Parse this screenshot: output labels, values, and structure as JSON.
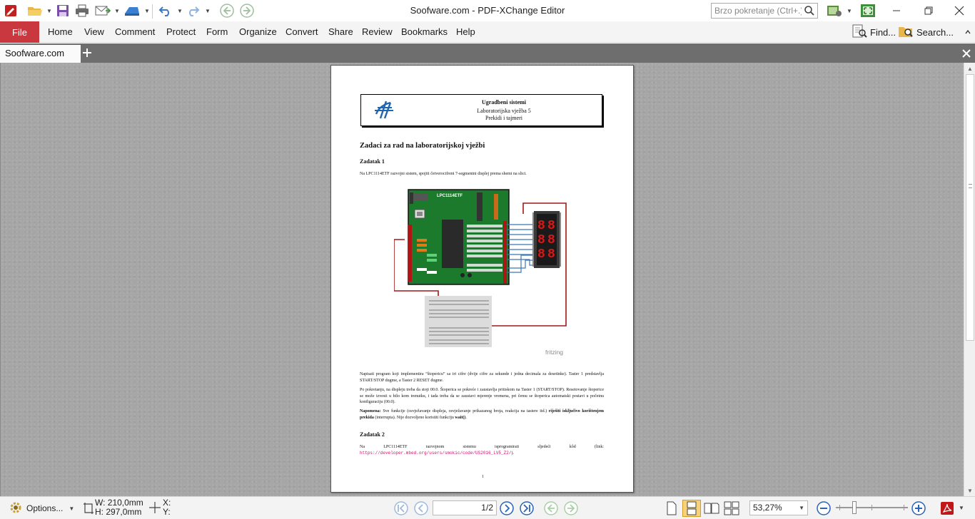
{
  "window": {
    "title": "Soofware.com - PDF-XChange Editor",
    "quick_launch_placeholder": "Brzo pokretanje (Ctrl+.)"
  },
  "menu": {
    "file": "File",
    "items": [
      "Home",
      "View",
      "Comment",
      "Protect",
      "Form",
      "Organize",
      "Convert",
      "Share",
      "Review",
      "Bookmarks",
      "Help"
    ],
    "find": "Find...",
    "search": "Search..."
  },
  "tabs": {
    "active": "Soofware.com"
  },
  "document": {
    "header": {
      "title": "Ugradbeni sistemi",
      "line2": "Laboratorijska vježba 5",
      "line3": "Prekidi i tajmeri"
    },
    "heading": "Zadaci za rad na laboratorijskoj vježbi",
    "task1_title": "Zadatak 1",
    "task1_intro": "Na LPC1114ETF razvojni sistem, spojiti četverocifreni 7-segmentni displej prema shemi na slici.",
    "board_label": "LPC1114ETF",
    "fritzing": "fritzing",
    "p1": "Napisati program koji implementira “štopericu” sa tri cifre (dvije cifre za sekunde i jedna decimala za desetinke). Taster 1 predstavlja START/STOP dugme, a Taster 2 RESET dugme.",
    "p2": "Po pokretanju, na displeju treba da stoji 00.0. Štoperica se pokreće i zaustavlja pritiskom na Taster 1 (START/STOP). Resetovanje štoperice se može izvesti u bilo kom trenutku, i tada treba da se zaustavi mjerenje vremena, pri čemu se štoperica automatski postavi u početnu konfiguraciju (00.0).",
    "note_label": "Napomena:",
    "note_text": "Sve funkcije (osvježavanje displeja, osvježavanje prikazanog broja, reakcija na tastere itd.)",
    "note_bold": "riješiti isključivo korištenjem prekida",
    "note_tail": "(interrupta). Nije dozvoljeno koristiti funkciju",
    "note_func": "wait()",
    "task2_title": "Zadatak 2",
    "task2_text": "Na LPC1114ETF razvojnom sistemu isprogramirati sljedeći kôd (link:",
    "task2_link": "https://developer.mbed.org/users/smokic/code/US2016_LV5_Z2/",
    "task2_end": ").",
    "page_number": "1"
  },
  "status": {
    "options": "Options...",
    "width": "W: 210,0mm",
    "height": "H: 297,0mm",
    "x": "X:",
    "y": "Y:",
    "page_current": "1",
    "page_total": "/2",
    "zoom": "53,27%"
  },
  "colors": {
    "file_tab": "#c9383e",
    "tab_bar": "#6e6e6e",
    "workarea": "#a6a6a6",
    "board": "#1c7a2c",
    "wire_red": "#a01818",
    "wire_blue": "#3a78b8",
    "display": "#c01818",
    "link": "#d0106b"
  }
}
